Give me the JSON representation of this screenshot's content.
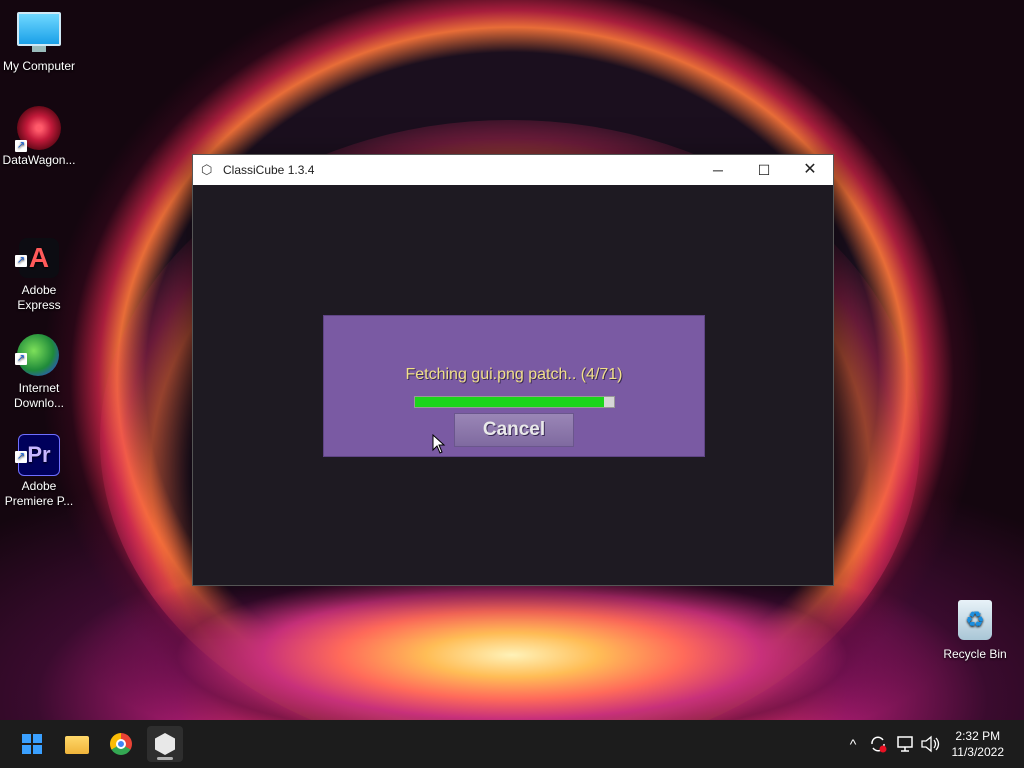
{
  "desktop": {
    "icons": [
      {
        "label": "My Computer"
      },
      {
        "label": "DataWagon..."
      },
      {
        "label": "Adobe\nExpress"
      },
      {
        "label": "Internet\nDownlo..."
      },
      {
        "label": "Adobe\nPremiere P..."
      },
      {
        "label": "Recycle Bin"
      }
    ]
  },
  "window": {
    "title": "ClassiCube 1.3.4",
    "controls": {
      "minimize": "─",
      "maximize": "☐",
      "close": "✕"
    }
  },
  "dialog": {
    "status": "Fetching gui.png patch.. (4/71)",
    "progress_fraction": 0.95,
    "cancel_label": "Cancel"
  },
  "taskbar": {
    "apps": [
      {
        "name": "start-icon"
      },
      {
        "name": "file-explorer-icon"
      },
      {
        "name": "chrome-icon"
      },
      {
        "name": "classicube-icon",
        "active": true
      }
    ],
    "tray": {
      "chevron": "^",
      "clock_time": "2:32 PM",
      "clock_date": "11/3/2022"
    }
  }
}
